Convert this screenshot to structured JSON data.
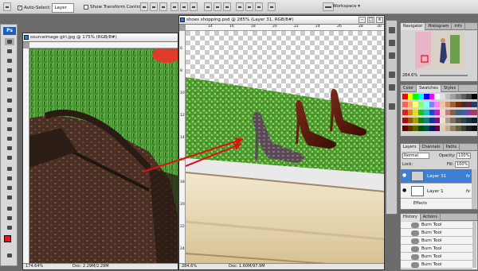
{
  "options_bar": {
    "auto_select_label": "Auto-Select:",
    "auto_select_value": "Layer",
    "show_transform_label": "Show Transform Controls",
    "workspace_label": "Workspace ▾"
  },
  "toolbox": {
    "logo": "Ps"
  },
  "doc_left": {
    "title": "sourceimage girl.jpg @ 175% (RGB/8#)",
    "zoom": "174.64%",
    "doc_info": "Doc: 2.29M/2.29M"
  },
  "doc_main": {
    "title": "shoes shopping.psd @ 285% (Layer 31, RGB/8#)",
    "zoom": "284.6%",
    "doc_info": "Doc: 1.60M/97.9M",
    "ruler_h": [
      "14",
      "16",
      "18",
      "20",
      "22",
      "24",
      "26",
      "28",
      "30"
    ],
    "ruler_v": [
      "6",
      "8",
      "10",
      "12",
      "14",
      "16",
      "18",
      "20",
      "22",
      "24"
    ]
  },
  "navigator": {
    "tabs": [
      "Navigator",
      "Histogram",
      "Info"
    ],
    "zoom": "284.6%"
  },
  "swatches": {
    "tabs": [
      "Color",
      "Swatches",
      "Styles"
    ],
    "colors": [
      "#ff0000",
      "#ffff00",
      "#00ff00",
      "#00ffff",
      "#0000ff",
      "#ff00ff",
      "#ffffff",
      "#e0e0e0",
      "#c0c0c0",
      "#a0a0a0",
      "#808080",
      "#606060",
      "#404040",
      "#000000",
      "#ff6060",
      "#ffb060",
      "#ffff80",
      "#80ff80",
      "#80ffff",
      "#8080ff",
      "#ff80ff",
      "#f0c0a0",
      "#d09060",
      "#a06030",
      "#703010",
      "#403020",
      "#602040",
      "#204060",
      "#e02020",
      "#e08020",
      "#e0e020",
      "#20c020",
      "#20c0c0",
      "#2040e0",
      "#c020c0",
      "#ffd0c0",
      "#c08080",
      "#806040",
      "#406080",
      "#4060a0",
      "#8040a0",
      "#a04060",
      "#a01010",
      "#a05010",
      "#a0a010",
      "#108010",
      "#108080",
      "#1030a0",
      "#801080",
      "#f0e0d0",
      "#b0a090",
      "#807060",
      "#505040",
      "#304050",
      "#203040",
      "#102030",
      "#600000",
      "#603000",
      "#606000",
      "#005000",
      "#005050",
      "#001860",
      "#500050",
      "#e0d0b0",
      "#c0b090",
      "#908060",
      "#606040",
      "#404030",
      "#202020",
      "#101010"
    ]
  },
  "layers": {
    "tabs": [
      "Layers",
      "Channels",
      "Paths"
    ],
    "blend_mode": "Normal",
    "opacity_label": "Opacity:",
    "opacity_value": "100%",
    "lock_label": "Lock:",
    "fill_label": "Fill:",
    "fill_value": "100%",
    "items": [
      {
        "name": "Layer 31",
        "fx": "fx"
      },
      {
        "name": "Layer 1",
        "fx": "fx"
      }
    ],
    "effects_label": "Effects"
  },
  "history": {
    "tabs": [
      "History",
      "Actions"
    ],
    "items": [
      "Burn Tool",
      "Burn Tool",
      "Burn Tool",
      "Burn Tool",
      "Burn Tool",
      "Burn Tool"
    ]
  },
  "colors": {
    "foreground": "#e4161b",
    "background": "#ffffff",
    "selection": "#3e7fd6"
  }
}
